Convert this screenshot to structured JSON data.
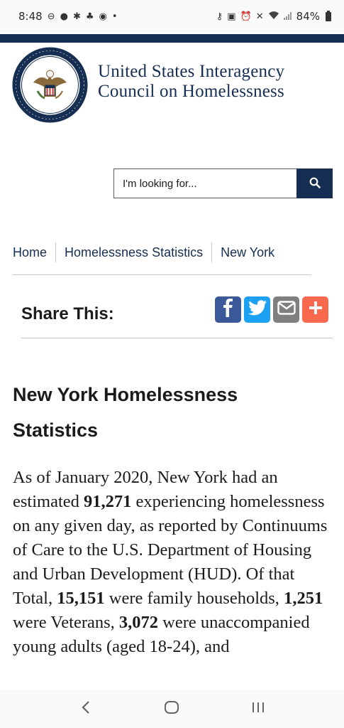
{
  "status": {
    "time": "8:48",
    "battery": "84%",
    "left_icons": [
      "do-not-disturb-icon",
      "messenger-icon",
      "slack-icon",
      "notification-icon",
      "facebook-icon",
      "dot-icon"
    ],
    "right_icons": [
      "key-icon",
      "lock-icon",
      "alarm-icon",
      "mute-icon",
      "wifi-icon",
      "signal-icon"
    ]
  },
  "header": {
    "title_line1": "United States Interagency",
    "title_line2": "Council on Homelessness"
  },
  "search": {
    "placeholder": "I'm looking for..."
  },
  "breadcrumb": [
    "Home",
    "Homelessness Statistics",
    "New York"
  ],
  "share": {
    "label": "Share This:",
    "colors": {
      "facebook": "#3b5998",
      "twitter": "#1da1f2",
      "email": "#7f7f7f",
      "more": "#f8694d"
    }
  },
  "article": {
    "title": "New York Homelessness Statistics",
    "p1": "As of January 2020, New York had an estimated ",
    "total": "91,271",
    "p2": " experiencing homelessness on any given day, as reported by Continuums of Care to the U.S. Department of Housing and Urban Development (HUD). Of that Total, ",
    "families": "15,151",
    "p3": " were family households, ",
    "veterans": "1,251",
    "p4": " were Veterans, ",
    "youth": "3,072",
    "p5": " were unaccompanied young adults (aged 18-24), and"
  },
  "colors": {
    "navy": "#162e51",
    "text": "#1b1b1b",
    "rule": "#c9c9c9"
  }
}
